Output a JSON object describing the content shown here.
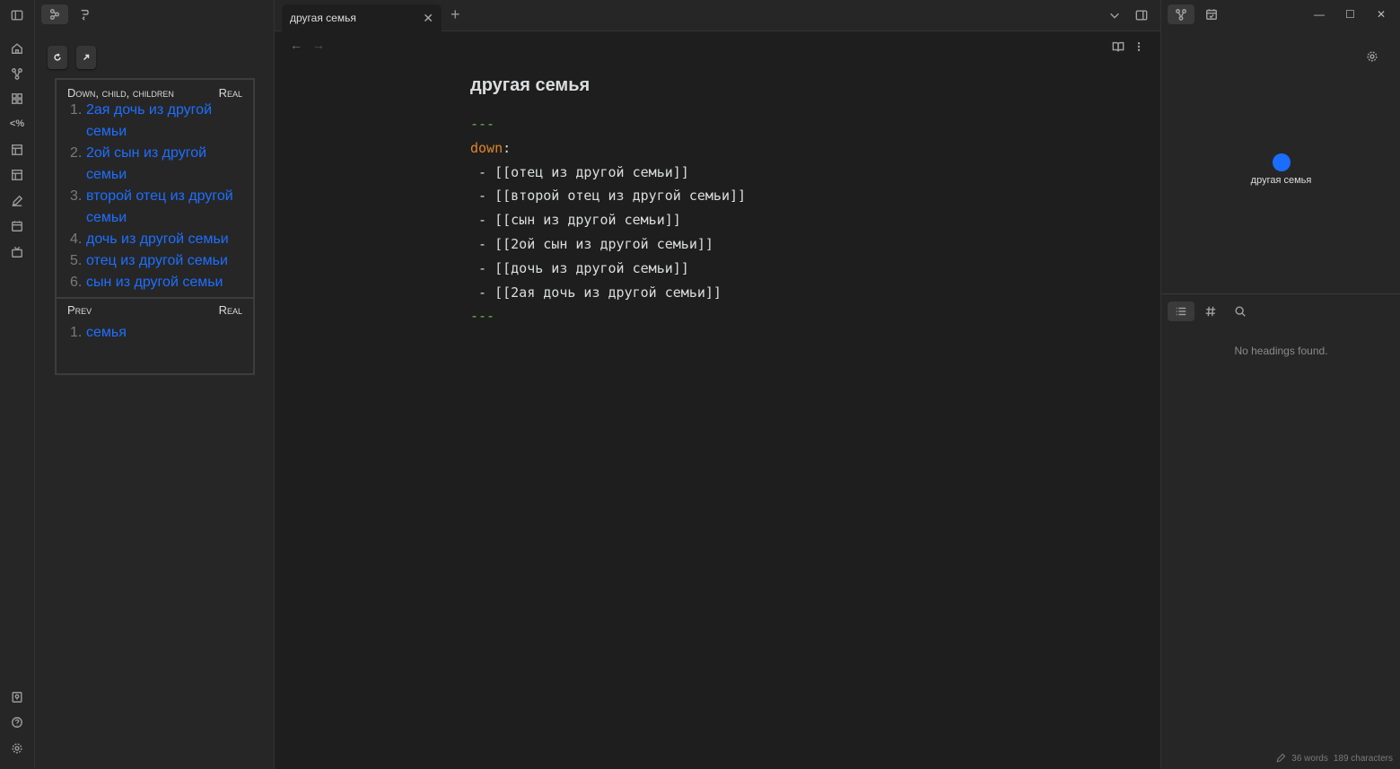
{
  "tab": {
    "title": "другая семья",
    "close_glyph": "✕",
    "new_tab_glyph": "+"
  },
  "nav": {
    "back": "←",
    "forward": "→"
  },
  "breadcrumbs": {
    "down_header": "Down, child, children",
    "down_right": "Real",
    "down_items": [
      {
        "num": "1.",
        "label": "2ая дочь из другой семьи"
      },
      {
        "num": "2.",
        "label": "2ой сын из другой семьи"
      },
      {
        "num": "3.",
        "label": "второй отец из другой семьи"
      },
      {
        "num": "4.",
        "label": "дочь из другой семьи"
      },
      {
        "num": "5.",
        "label": "отец из другой семьи"
      },
      {
        "num": "6.",
        "label": "сын из другой семьи"
      }
    ],
    "prev_header": "Prev",
    "prev_right": "Real",
    "prev_items": [
      {
        "num": "1.",
        "label": "семья"
      }
    ]
  },
  "note": {
    "title": "другая семья",
    "fm_open": "---",
    "fm_key": "down",
    "fm_colon": ":",
    "lines": [
      " - [[отец из другой семьи]]",
      " - [[второй отец из другой семьи]]",
      " - [[сын из другой семьи]]",
      " - [[2ой сын из другой семьи]]",
      " - [[дочь из другой семьи]]",
      " - [[2ая дочь из другой семьи]]"
    ],
    "fm_close": "---"
  },
  "graph": {
    "node_label": "другая семья",
    "node_color": "#1a6dff"
  },
  "outline": {
    "empty_message": "No headings found."
  },
  "status": {
    "words": "36 words",
    "characters": "189 characters"
  },
  "window": {
    "minimize": "—",
    "maximize": "☐",
    "close": "✕"
  },
  "colors": {
    "link": "#1e6fff",
    "frontmatter_dash": "#6bbd4a",
    "frontmatter_key": "#e2852b"
  }
}
